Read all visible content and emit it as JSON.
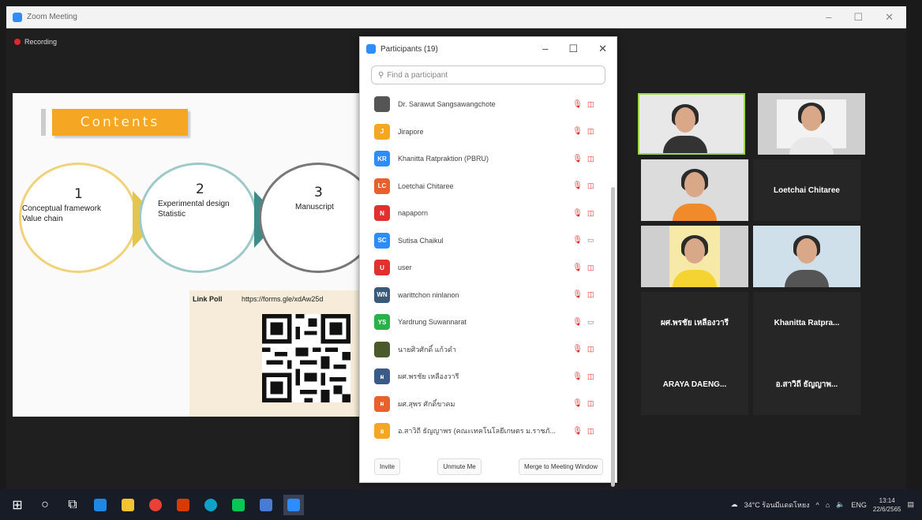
{
  "window": {
    "title": "Zoom Meeting",
    "controls": [
      "–",
      "☐",
      "✕"
    ]
  },
  "recording": {
    "label": "Recording"
  },
  "slide": {
    "heading": "Contents",
    "items": [
      {
        "number": "1",
        "lines": [
          "Conceptual framework",
          "Value chain"
        ]
      },
      {
        "number": "2",
        "lines": [
          "Experimental design",
          "Statistic"
        ]
      },
      {
        "number": "3",
        "lines": [
          "Manuscript"
        ]
      }
    ],
    "poll_label": "Link Poll",
    "poll_link": "https://forms.gle/xdAw25d"
  },
  "participants": {
    "title": "Participants (19)",
    "controls": [
      "–",
      "☐",
      "✕"
    ],
    "search_placeholder": "Find a participant",
    "list": [
      {
        "name": "Dr. Sarawut Sangsawangchote",
        "initials": "",
        "color": "#555555",
        "cam_on": false
      },
      {
        "name": "Jirapore",
        "initials": "J",
        "color": "#f5a623",
        "cam_on": false
      },
      {
        "name": "Khanitta Ratpraktion (PBRU)",
        "initials": "KR",
        "color": "#2d8cff",
        "cam_on": false
      },
      {
        "name": "Loetchai Chitaree",
        "initials": "LC",
        "color": "#e8602c",
        "cam_on": false
      },
      {
        "name": "napaporn",
        "initials": "N",
        "color": "#e03030",
        "cam_on": false
      },
      {
        "name": "Sutisa Chaikul",
        "initials": "SC",
        "color": "#2d8cff",
        "cam_on": true
      },
      {
        "name": "user",
        "initials": "U",
        "color": "#e03030",
        "cam_on": false
      },
      {
        "name": "warittchon ninlanon",
        "initials": "WN",
        "color": "#3a5a7a",
        "cam_on": false
      },
      {
        "name": "Yardrung Suwannarat",
        "initials": "YS",
        "color": "#2bb04a",
        "cam_on": true
      },
      {
        "name": "นายศิวศักดิ์ แก้วดำ",
        "initials": "",
        "color": "#4a5a2a",
        "cam_on": false
      },
      {
        "name": "ผศ.พรชัย เหลืองวารี",
        "initials": "ผ",
        "color": "#3a5a8a",
        "cam_on": false
      },
      {
        "name": "ผศ.สุพร ศักดิ์ขาคม",
        "initials": "ผ",
        "color": "#e8602c",
        "cam_on": false
      },
      {
        "name": "อ.สาวิถี ธัญญาพร (คณะเทคโนโลยีเกษตร ม.ราชภั...",
        "initials": "อ",
        "color": "#f5a623",
        "cam_on": false
      }
    ],
    "buttons": {
      "invite": "Invite",
      "unmute": "Unmute Me",
      "merge": "Merge to Meeting Window"
    }
  },
  "gallery": {
    "name_tiles": [
      "Loetchai Chitaree",
      "ผศ.พรชัย เหลืองวารี",
      "Khanitta Ratpra...",
      "ARAYA DAENG...",
      "อ.สาวิถี ธัญญาพ..."
    ]
  },
  "taskbar": {
    "weather": "34°C ร้อนมีแดดโหยง",
    "lang": "ENG",
    "time": "13:14",
    "date": "22/6/2565"
  }
}
